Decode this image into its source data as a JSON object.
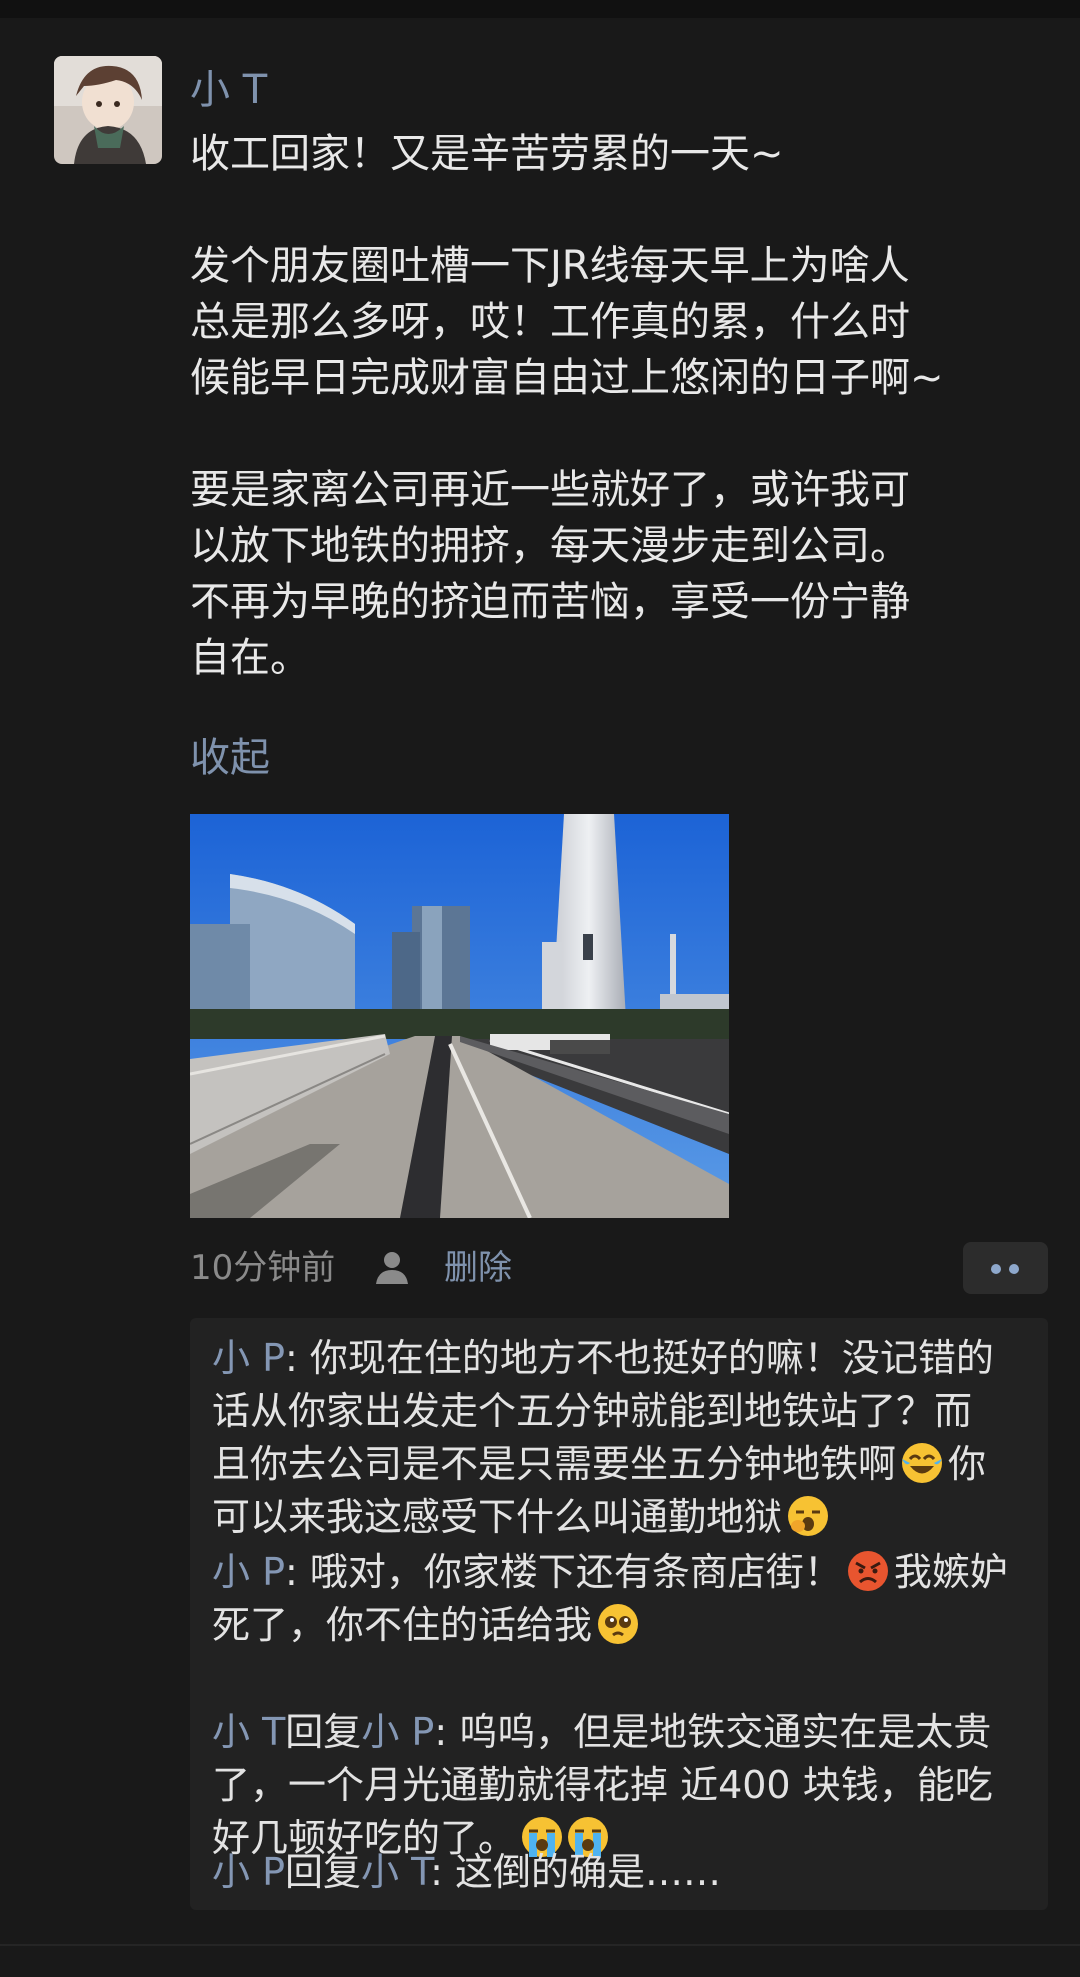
{
  "post": {
    "author": "小 T",
    "text_lines_1": [
      "收工回家！又是辛苦劳累的一天~"
    ],
    "text_lines_2": [
      "发个朋友圈吐槽一下JR线每天早上为啥人",
      "总是那么多呀，哎！工作真的累，什么时",
      "候能早日完成财富自由过上悠闲的日子啊~"
    ],
    "text_lines_3": [
      "要是家离公司再近一些就好了，或许我可",
      "以放下地铁的拥挤，每天漫步走到公司。",
      "不再为早晚的挤迫而苦恼，享受一份宁静",
      "自在。"
    ],
    "collapse_label": "收起",
    "time": "10分钟前",
    "delete_label": "删除"
  },
  "comments": {
    "c1": {
      "name": "小 P",
      "sep": ": ",
      "l1": "你现在住的地方不也挺好的嘛！没记错的",
      "l2": "话从你家出发走个五分钟就能到地铁站了？而",
      "l3": "且你去公司是不是只需要坐五分钟地铁啊",
      "l3_tail": "你",
      "l4": "可以来我这感受下什么叫通勤地狱"
    },
    "c2": {
      "name": "小 P",
      "sep": ": ",
      "l1": "哦对，你家楼下还有条商店街！",
      "l1_tail": "我嫉妒",
      "l2": "死了，你不住的话给我"
    },
    "c3": {
      "name": "小 T",
      "reply_word": "回复",
      "target": "小 P",
      "sep": ": ",
      "l1": "呜呜，但是地铁交通实在是太贵",
      "l2": "了，一个月光通勤就得花掉 近400 块钱，能吃",
      "l3": "好几顿好吃的了。"
    },
    "c4": {
      "name": "小 P",
      "reply_word": "回复",
      "target": "小 T",
      "sep": ": ",
      "l1": "这倒的确是……"
    }
  },
  "icons": {
    "emoji_laugh": "tears-of-joy",
    "emoji_yawn": "yawning-face",
    "emoji_angry": "angry-face",
    "emoji_pleading": "pleading-face",
    "emoji_cry": "loudly-crying-face"
  },
  "colors": {
    "background": "#191919",
    "link": "#7f92ad",
    "comment_bg": "#222222"
  }
}
